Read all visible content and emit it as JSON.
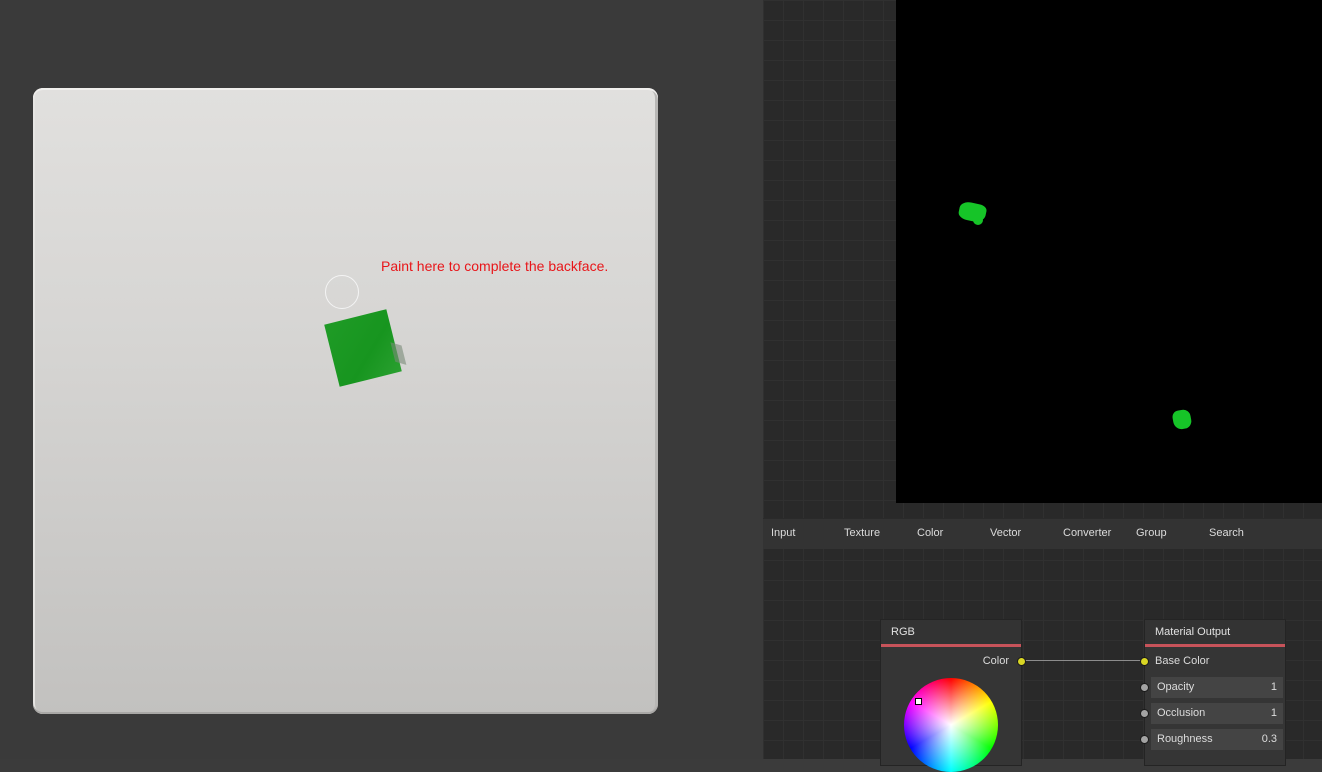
{
  "viewport": {
    "hint_text": "Paint here to complete the backface."
  },
  "menu": {
    "items": [
      "Input",
      "Texture",
      "Color",
      "Vector",
      "Converter",
      "Group",
      "Search"
    ]
  },
  "nodes": {
    "rgb": {
      "title": "RGB",
      "output_label": "Color"
    },
    "material_output": {
      "title": "Material Output",
      "inputs": [
        {
          "label": "Base Color"
        },
        {
          "label": "Opacity",
          "value": "1"
        },
        {
          "label": "Occlusion",
          "value": "1"
        },
        {
          "label": "Roughness",
          "value": "0.3"
        }
      ]
    }
  },
  "colors": {
    "paint": "#1a9a22",
    "header_accent": "#c7535a",
    "socket_color": "#d9d624",
    "hint": "#e8161a"
  }
}
